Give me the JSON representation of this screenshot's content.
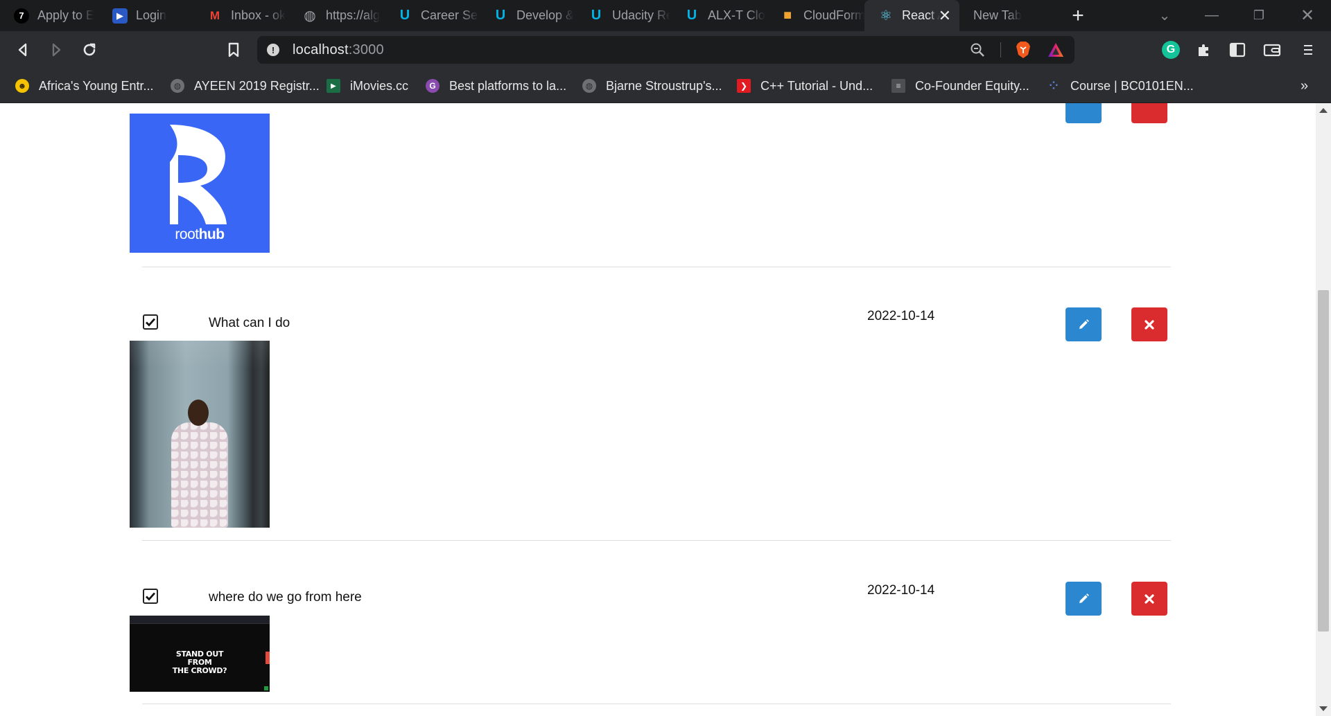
{
  "browser": {
    "tabs": [
      {
        "label": "Apply to E",
        "icon": "seven-logo-icon",
        "color": "#ffffff",
        "bg": "#000000",
        "glyph": "7"
      },
      {
        "label": "Login",
        "icon": "arrow-logo-icon",
        "color": "#ffffff",
        "bg": "#2b59c3",
        "glyph": "▶"
      },
      {
        "label": "Inbox - ok",
        "icon": "gmail-icon",
        "color": "#ea4335",
        "bg": "transparent",
        "glyph": "M"
      },
      {
        "label": "https://alg",
        "icon": "globe-icon",
        "color": "#9ea1a6",
        "bg": "transparent",
        "glyph": "◍"
      },
      {
        "label": "Career Serv",
        "icon": "udacity-icon",
        "color": "#02b3e4",
        "bg": "transparent",
        "glyph": "U"
      },
      {
        "label": "Develop &",
        "icon": "udacity-icon",
        "color": "#02b3e4",
        "bg": "transparent",
        "glyph": "U"
      },
      {
        "label": "Udacity Re",
        "icon": "udacity-icon",
        "color": "#02b3e4",
        "bg": "transparent",
        "glyph": "U"
      },
      {
        "label": "ALX-T Clo",
        "icon": "udacity-icon",
        "color": "#02b3e4",
        "bg": "transparent",
        "glyph": "U"
      },
      {
        "label": "CloudForm",
        "icon": "aws-box-icon",
        "color": "#f0a32f",
        "bg": "transparent",
        "glyph": "■"
      },
      {
        "label": "React A",
        "icon": "react-icon",
        "color": "#61dafb",
        "bg": "transparent",
        "glyph": "⚛",
        "active": true
      },
      {
        "label": "New Tab",
        "icon": "",
        "color": "#9ea1a6",
        "bg": "transparent",
        "glyph": ""
      }
    ],
    "url_host": "localhost",
    "url_port": ":3000",
    "bookmarks": [
      {
        "label": "Africa's Young Entr...",
        "icon": "smiley-icon",
        "color": "#f5c400",
        "glyph": "☻"
      },
      {
        "label": "AYEEN 2019 Registr...",
        "icon": "globe-icon",
        "color": "#bdbdbd",
        "glyph": "◍"
      },
      {
        "label": "iMovies.cc",
        "icon": "imovies-icon",
        "color": "#21a05a",
        "glyph": "▶"
      },
      {
        "label": "Best platforms to la...",
        "icon": "gatsby-icon",
        "color": "#8a4baf",
        "glyph": "G"
      },
      {
        "label": "Bjarne Stroustrup's...",
        "icon": "globe-icon",
        "color": "#bdbdbd",
        "glyph": "◍"
      },
      {
        "label": "C++ Tutorial - Und...",
        "icon": "chevron-red-icon",
        "color": "#e21b23",
        "glyph": "❯"
      },
      {
        "label": "Co-Founder Equity...",
        "icon": "startup-icon",
        "color": "#9a9a9a",
        "glyph": "≡"
      },
      {
        "label": "Course | BC0101EN...",
        "icon": "cognitive-class-icon",
        "color": "#5a7fd6",
        "glyph": "⁘"
      }
    ]
  },
  "todos": [
    {
      "text": "What can I do",
      "date": "2022-10-14",
      "checked": true,
      "image": "photo"
    },
    {
      "text": "where do we go from here",
      "date": "2022-10-14",
      "checked": true,
      "image": "screenshot"
    }
  ],
  "logo": {
    "text_light": "root",
    "text_bold": "hub",
    "color": "#3a66f5"
  },
  "screenshot_headline": [
    "STAND OUT",
    "FROM",
    "THE CROWD?"
  ],
  "colors": {
    "edit": "#2a87d0",
    "delete": "#da2c2f"
  }
}
